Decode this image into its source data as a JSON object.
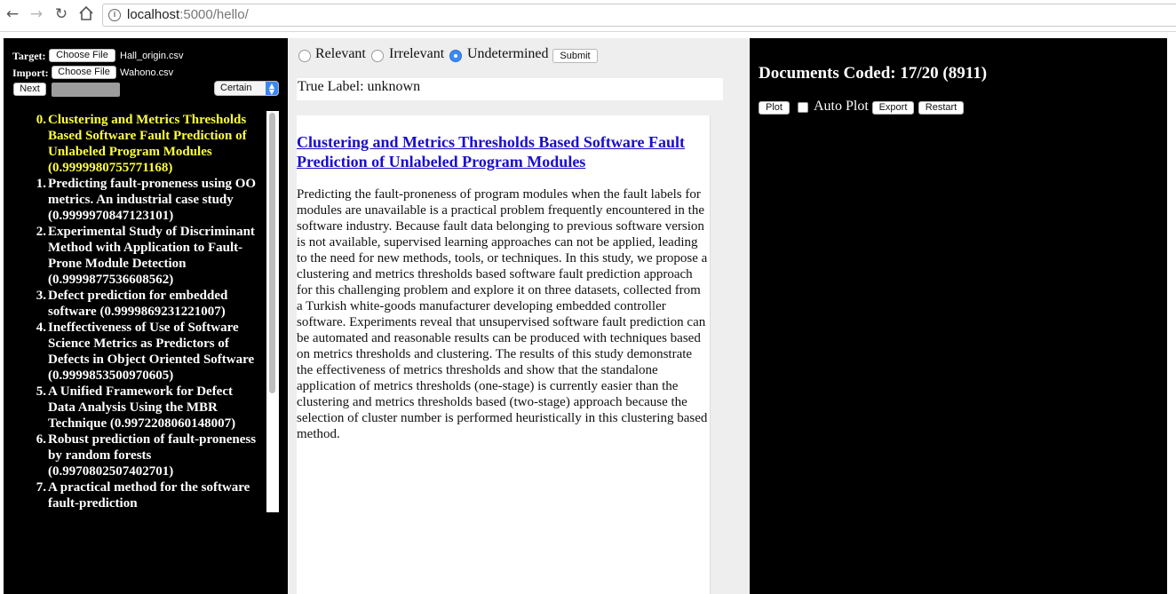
{
  "browser": {
    "url_host": "localhost",
    "url_rest": ":5000/hello/",
    "icons": {
      "back": "arrow-left-icon",
      "forward": "arrow-right-icon",
      "reload": "reload-icon",
      "home": "home-icon",
      "info": "info-icon"
    }
  },
  "left": {
    "target_label": "Target:",
    "target_button": "Choose File",
    "target_file": "Hall_origin.csv",
    "import_label": "Import:",
    "import_button": "Choose File",
    "import_file": "Wahono.csv",
    "next_button": "Next",
    "certainty_value": "Certain",
    "documents": [
      {
        "num": "0.",
        "text": "Clustering and Metrics Thresholds Based Software Fault Prediction of Unlabeled Program Modules (0.9999980755771168)",
        "current": true
      },
      {
        "num": "1.",
        "text": "Predicting fault-proneness using OO metrics. An industrial case study (0.9999970847123101)"
      },
      {
        "num": "2.",
        "text": "Experimental Study of Discriminant Method with Application to Fault-Prone Module Detection (0.9999877536608562)"
      },
      {
        "num": "3.",
        "text": "Defect prediction for embedded software (0.9999869231221007)"
      },
      {
        "num": "4.",
        "text": "Ineffectiveness of Use of Software Science Metrics as Predictors of Defects in Object Oriented Software (0.9999853500970605)"
      },
      {
        "num": "5.",
        "text": "A Unified Framework for Defect Data Analysis Using the MBR Technique (0.9972208060148007)"
      },
      {
        "num": "6.",
        "text": "Robust prediction of fault-proneness by random forests (0.9970802507402701)"
      },
      {
        "num": "7.",
        "text": "A practical method for the software fault-prediction"
      }
    ]
  },
  "middle": {
    "radio_relevant": "Relevant",
    "radio_irrelevant": "Irrelevant",
    "radio_undetermined": "Undetermined",
    "selected": "Undetermined",
    "submit_button": "Submit",
    "true_label": "True Label: unknown",
    "doc_title": "Clustering and Metrics Thresholds Based Software Fault Prediction of Unlabeled Program Modules",
    "doc_abstract": "Predicting the fault-proneness of program modules when the fault labels for modules are unavailable is a practical problem frequently encountered in the software industry. Because fault data belonging to previous software version is not available, supervised learning approaches can not be applied, leading to the need for new methods, tools, or techniques. In this study, we propose a clustering and metrics thresholds based software fault prediction approach for this challenging problem and explore it on three datasets, collected from a Turkish white-goods manufacturer developing embedded controller software. Experiments reveal that unsupervised software fault prediction can be automated and reasonable results can be produced with techniques based on metrics thresholds and clustering. The results of this study demonstrate the effectiveness of metrics thresholds and show that the standalone application of metrics thresholds (one-stage) is currently easier than the clustering and metrics thresholds based (two-stage) approach because the selection of cluster number is performed heuristically in this clustering based method."
  },
  "right": {
    "docs_coded": "Documents Coded: 17/20 (8911)",
    "plot_button": "Plot",
    "auto_plot_label": "Auto Plot",
    "auto_plot_checked": false,
    "export_button": "Export",
    "restart_button": "Restart"
  }
}
